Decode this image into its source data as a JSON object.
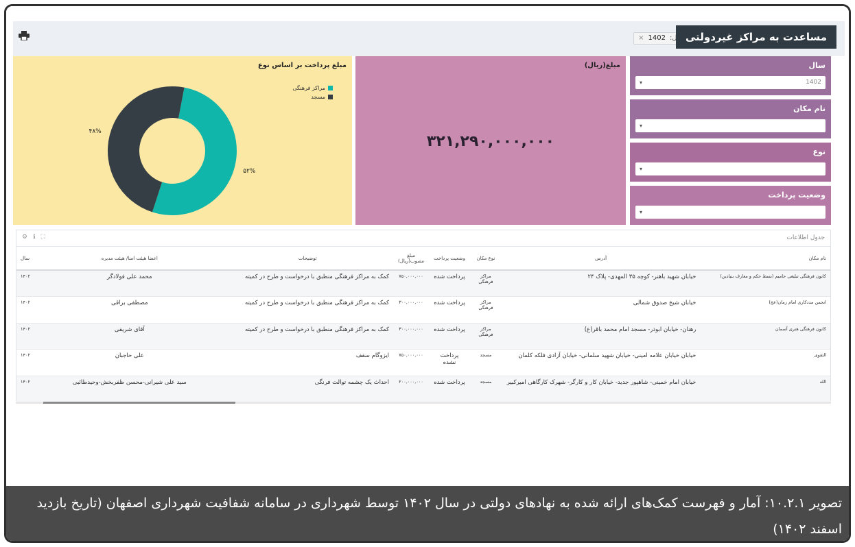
{
  "header": {
    "title": "مساعدت به مراکز غیردولتی",
    "chip_label": "سال:",
    "chip_value": "1402",
    "chip_close": "×",
    "print_icon": "print-icon"
  },
  "amount_panel": {
    "label": "مبلغ(ریال)",
    "value": "۳۲۱,۲۹۰,۰۰۰,۰۰۰"
  },
  "filters": [
    {
      "label": "سال",
      "value": "1402",
      "caret": "▾"
    },
    {
      "label": "نام مکان",
      "value": "",
      "caret": "▾"
    },
    {
      "label": "نوع",
      "value": "",
      "caret": "▾"
    },
    {
      "label": "وضعیت پرداخت",
      "value": "",
      "caret": "▾"
    }
  ],
  "chart_data": {
    "type": "pie",
    "title": "مبلغ پرداخت بر اساس نوع",
    "categories": [
      "مراکز فرهنگی",
      "مسجد"
    ],
    "values": [
      52,
      48
    ],
    "labels": [
      "۵۲%",
      "۴۸%"
    ],
    "colors": [
      "#10b6aa",
      "#353e45"
    ],
    "donut": true,
    "legend_position": "top-right"
  },
  "table": {
    "title": "جدول اطلاعات",
    "icons": [
      "gear-icon",
      "info-icon",
      "expand-icon"
    ],
    "columns": [
      "نام مکان",
      "آدرس",
      "نوع مکان",
      "وضعیت پرداخت",
      "مبلغ مصوب(ریال)",
      "توضیحات",
      "اعضا هیئت امنا/ هیئت مدیره",
      "سال"
    ],
    "rows": [
      [
        "کانون فرهنگی تبلیغی حامیم (بسط حکم و معارف بنیادین)",
        "خیابان شهید باهنر- کوچه ۳۵ المهدی- پلاک ۲۴",
        "مراکز فرهنگی",
        "پرداخت شده",
        "۷۵۰,۰۰۰,۰۰۰",
        "کمک به مراکز فرهنگی منطبق با درخواست و طرح در کمیته",
        "محمد علی فولادگر",
        "۱۴۰۲"
      ],
      [
        "انجمن مددکاری امام زمان(عج)",
        "خیابان شیخ صدوق شمالی",
        "مراکز فرهنگی",
        "پرداخت شده",
        "۳۰۰,۰۰۰,۰۰۰",
        "کمک به مراکز فرهنگی منطبق با درخواست و طرح در کمیته",
        "مصطفی براقی",
        "۱۴۰۲"
      ],
      [
        "کانون فرهنگی هنری آسمان",
        "رهنان- خیابان ابوذر- مسجد امام محمد باقر(ع)",
        "مراکز فرهنگی",
        "پرداخت شده",
        "۳۰۰,۰۰۰,۰۰۰",
        "کمک به مراکز فرهنگی منطبق با درخواست و طرح در کمیته",
        "آقای شریفی",
        "۱۴۰۲"
      ],
      [
        "التقوی",
        "خیابان خیابان علامه امینی- خیابان شهید سلمانی- خیابان آزادی فلکه کلمان",
        "مسجد",
        "پرداخت نشده",
        "۷۵۰,۰۰۰,۰۰۰",
        "ایزوگام سقف",
        "علی حاجبان",
        "۱۴۰۲"
      ],
      [
        "الله",
        "خیابان امام خمینی- شاهپور جدید- خیابان کار و کارگر- شهرک کارگاهی امیرکبیر",
        "مسجد",
        "پرداخت شده",
        "۲۰۰,۰۰۰,۰۰۰",
        "احداث یک چشمه توالت فرنگی",
        "سید علی شیرانی-محسن ظفربخش-وحیدطائبی",
        "۱۴۰۲"
      ]
    ]
  },
  "caption": "تصویر ۱۰.۲.۱: آمار و فهرست کمک‌های ارائه شده به نهادهای دولتی در سال ۱۴۰۲ توسط شهرداری در سامانه شفافیت شهرداری اصفهان (تاریخ بازدید اسفند ۱۴۰۲)"
}
